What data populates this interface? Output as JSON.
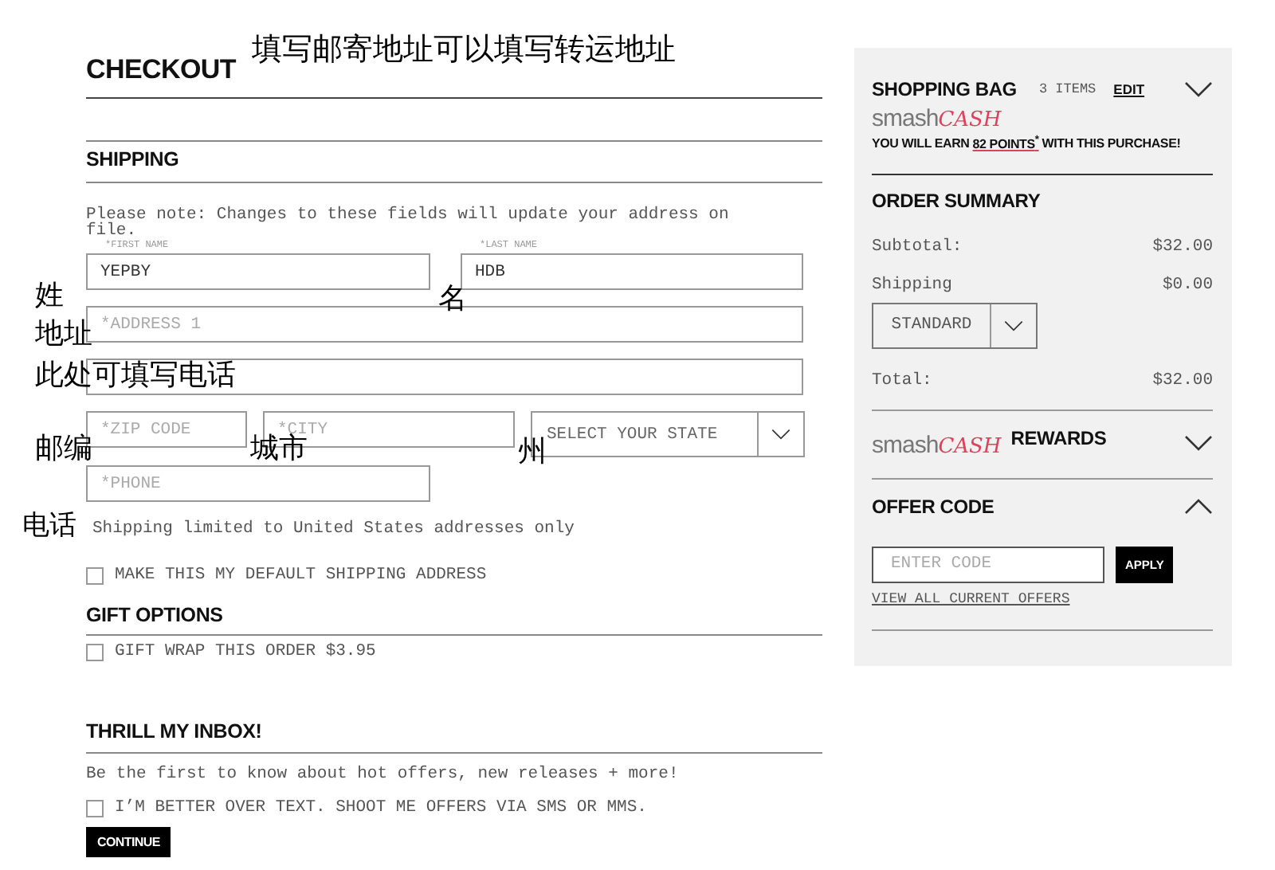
{
  "annotations": [
    {
      "text": "填写邮寄地址可以填写转运地址"
    },
    {
      "text": "姓"
    },
    {
      "text": "名"
    },
    {
      "text": "地址"
    },
    {
      "text": "此处可填写电话"
    },
    {
      "text": "邮编"
    },
    {
      "text": "城市"
    },
    {
      "text": "州"
    },
    {
      "text": "电话"
    }
  ],
  "checkout": {
    "title": "CHECKOUT"
  },
  "shipping": {
    "heading": "SHIPPING",
    "note": "Please note: Changes to these fields will update your address on file.",
    "fields": [
      {
        "kind": "labeled",
        "label": "*FIRST NAME",
        "value": "YEPBY"
      },
      {
        "kind": "labeled",
        "label": "*LAST NAME",
        "value": "HDB"
      },
      {
        "kind": "text",
        "placeholder": "*ADDRESS 1"
      },
      {
        "kind": "text"
      },
      {
        "kind": "text",
        "placeholder": "*ZIP CODE"
      },
      {
        "kind": "text",
        "placeholder": "*CITY"
      },
      {
        "kind": "select",
        "value": "SELECT YOUR STATE"
      },
      {
        "kind": "text",
        "placeholder": "*PHONE"
      }
    ],
    "limit": "Shipping limited to United States addresses only",
    "default_checkbox": {
      "label": "MAKE THIS MY DEFAULT SHIPPING ADDRESS",
      "checked": false
    }
  },
  "gift_options": {
    "heading": "GIFT OPTIONS",
    "checkbox": {
      "label": "GIFT WRAP THIS ORDER $3.95",
      "checked": false
    }
  },
  "thrill": {
    "heading": "THRILL MY INBOX!",
    "text": "Be the first to know about hot offers, new releases + more!",
    "checkbox": {
      "label": "I’M BETTER OVER TEXT. SHOOT ME OFFERS VIA SMS OR MMS.",
      "checked": false
    },
    "button": "CONTINUE"
  },
  "sidebar": {
    "bag": {
      "heading": "SHOPPING BAG",
      "count": "3 ITEMS",
      "edit": "EDIT",
      "expanded": false
    },
    "logo": {
      "smash": "smash",
      "cash": "CASH"
    },
    "earn": {
      "before": "YOU WILL EARN ",
      "points": "82 POINTS$^{*}$",
      "after": " WITH THIS PURCHASE!"
    },
    "summary": {
      "heading": "ORDER SUMMARY",
      "rows": [
        {
          "label": "Subtotal:",
          "value": "$32.00"
        },
        {
          "label": "Shipping",
          "value": "$0.00"
        }
      ],
      "method": "STANDARD",
      "total": {
        "label": "Total:",
        "value": "$32.00"
      }
    },
    "rewards": {
      "logo": {
        "smash": "smash",
        "cash": "CASH"
      },
      "label": "REWARDS",
      "expanded": false
    },
    "offer": {
      "heading": "OFFER CODE",
      "expanded": true,
      "placeholder": "ENTER CODE",
      "button": "APPLY",
      "link": "VIEW ALL CURRENT OFFERS"
    }
  }
}
